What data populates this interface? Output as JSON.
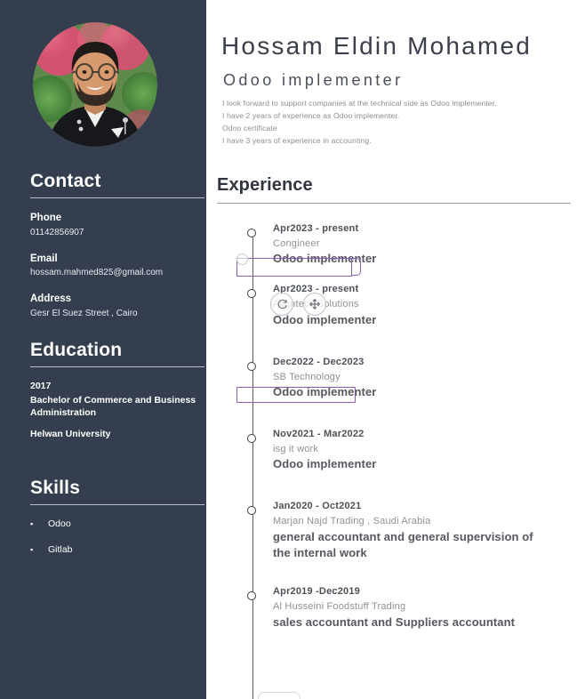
{
  "sidebar": {
    "avatar": {
      "icon": "avatar-photo",
      "alt": "portrait photo of man with glasses and beard in black jacket in front of pink and green flowers"
    },
    "contact": {
      "heading": "Contact",
      "fields": [
        {
          "label": "Phone",
          "value": "01142856907"
        },
        {
          "label": "Email",
          "value": "hossam.mahmed825@gmail.com"
        },
        {
          "label": "Address",
          "value": "Gesr El Suez Street , Cairo"
        }
      ]
    },
    "education": {
      "heading": "Education",
      "year": "2017",
      "degree": "Bachelor of Commerce and Business Administration",
      "school": "Helwan University"
    },
    "skills": {
      "heading": "Skills",
      "items": [
        "Odoo",
        "Gitlab"
      ],
      "bullet": "▪"
    }
  },
  "header": {
    "name": "Hossam Eldin  Mohamed",
    "job_title": "Odoo implementer",
    "summary_lines": [
      "I look forward to support companies at the technical side as Odoo implementer.",
      "I have 2 years of experience as Odoo implementer.",
      "Odoo certificate",
      "I have 3 years of experience in accounting."
    ]
  },
  "experience": {
    "heading": "Experience",
    "entries": [
      {
        "date": "Apr2023 - present",
        "company": "Congineer",
        "role": "Odoo implementer"
      },
      {
        "date": "Apr2023 - present",
        "company": "Alignteck Solutions",
        "role": "Odoo implementer"
      },
      {
        "date": "Dec2022 - Dec2023",
        "company": "SB Technology",
        "role": "Odoo implementer"
      },
      {
        "date": "Nov2021 - Mar2022",
        "company": "isg it work",
        "role": "Odoo implementer"
      },
      {
        "date": "Jan2020 - Oct2021",
        "company": "Marjan Najd Trading , Saudi Arabia",
        "role": "general accountant and general supervision of the internal work"
      },
      {
        "date": "Apr2019 -Dec2019",
        "company": "Al Husseini Foodstuff Trading",
        "role": "sales accountant and Suppliers accountant"
      }
    ]
  },
  "editor_overlay": {
    "selection_color": "#8b5cb8",
    "selected_elements": [
      "Odoo implementer",
      "Dec2022 - Dec2023"
    ],
    "handles": [
      {
        "icon": "rotate-icon"
      },
      {
        "icon": "move-icon"
      }
    ]
  },
  "colors": {
    "sidebar_bg": "#343e4f",
    "page_bg": "#ffffff",
    "heading_text": "#30353f",
    "body_text": "#8d9096",
    "selection": "#8b5cb8"
  }
}
